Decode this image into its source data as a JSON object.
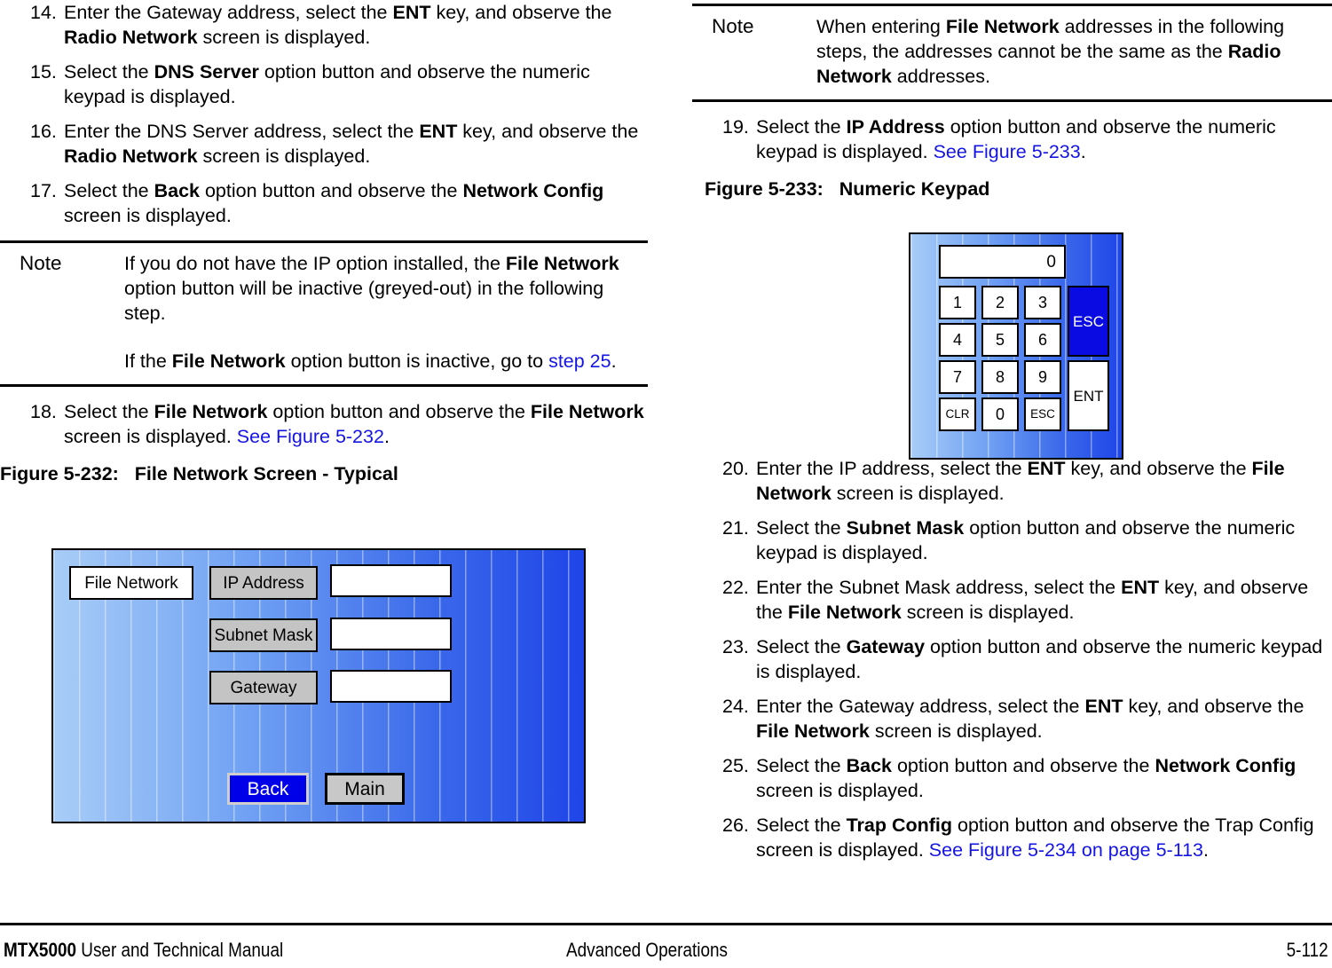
{
  "document": {
    "footer": {
      "manual_bold": "MTX5000",
      "manual_rest": " User and Technical Manual",
      "section": "Advanced Operations",
      "page": "5-112"
    }
  },
  "left_column": {
    "steps_before_note": [
      {
        "number": "14.",
        "segments": [
          {
            "t": "Enter the Gateway address, select the ",
            "s": "plain"
          },
          {
            "t": "ENT",
            "s": "bold"
          },
          {
            "t": " key, and observe the ",
            "s": "plain"
          },
          {
            "t": "Radio Network",
            "s": "bold"
          },
          {
            "t": " screen is displayed.",
            "s": "plain"
          }
        ]
      },
      {
        "number": "15.",
        "segments": [
          {
            "t": "Select the ",
            "s": "plain"
          },
          {
            "t": "DNS Server",
            "s": "bold"
          },
          {
            "t": " option button and observe the numeric keypad is displayed.",
            "s": "plain"
          }
        ]
      },
      {
        "number": "16.",
        "segments": [
          {
            "t": "Enter the DNS Server address, select the ",
            "s": "plain"
          },
          {
            "t": "ENT",
            "s": "bold"
          },
          {
            "t": " key, and observe the ",
            "s": "plain"
          },
          {
            "t": "Radio Network",
            "s": "bold"
          },
          {
            "t": " screen is displayed.",
            "s": "plain"
          }
        ]
      },
      {
        "number": "17.",
        "segments": [
          {
            "t": "Select the ",
            "s": "plain"
          },
          {
            "t": "Back",
            "s": "bold"
          },
          {
            "t": " option button and observe the ",
            "s": "plain"
          },
          {
            "t": "Network Config",
            "s": "bold"
          },
          {
            "t": " screen is displayed.",
            "s": "plain"
          }
        ]
      }
    ],
    "note": {
      "label": "Note",
      "paragraphs": [
        [
          {
            "t": "If you do not have the IP option installed, the ",
            "s": "plain"
          },
          {
            "t": "File Network",
            "s": "bold"
          },
          {
            "t": " option button will be inactive (greyed-out) in the following step.",
            "s": "plain"
          }
        ],
        [
          {
            "t": "If the ",
            "s": "plain"
          },
          {
            "t": "File Network",
            "s": "bold"
          },
          {
            "t": " option button is inactive, go to ",
            "s": "plain"
          },
          {
            "t": "step 25",
            "s": "link"
          },
          {
            "t": ".",
            "s": "plain"
          }
        ]
      ]
    },
    "steps_after_note": [
      {
        "number": "18.",
        "segments": [
          {
            "t": "Select the ",
            "s": "plain"
          },
          {
            "t": "File Network",
            "s": "bold"
          },
          {
            "t": " option button and observe the ",
            "s": "plain"
          },
          {
            "t": "File Network",
            "s": "bold"
          },
          {
            "t": " screen is displayed.  ",
            "s": "plain"
          },
          {
            "t": "See Figure 5-232",
            "s": "link"
          },
          {
            "t": ".",
            "s": "plain"
          }
        ]
      }
    ],
    "figure": {
      "caption": "Figure 5-232:   File Network Screen - Typical",
      "screen": {
        "title_button": "File Network",
        "rows": [
          {
            "option": "IP Address",
            "value": ""
          },
          {
            "option": "Subnet Mask",
            "value": ""
          },
          {
            "option": "Gateway",
            "value": ""
          }
        ],
        "back_button": "Back",
        "main_button": "Main"
      }
    }
  },
  "right_column": {
    "note": {
      "label": "Note",
      "paragraphs": [
        [
          {
            "t": "When entering ",
            "s": "plain"
          },
          {
            "t": "File Network",
            "s": "bold"
          },
          {
            "t": " addresses in the following steps, the addresses cannot be the same as the ",
            "s": "plain"
          },
          {
            "t": "Radio Network",
            "s": "bold"
          },
          {
            "t": " addresses.",
            "s": "plain"
          }
        ]
      ]
    },
    "steps_before_figure": [
      {
        "number": "19.",
        "segments": [
          {
            "t": "Select the ",
            "s": "plain"
          },
          {
            "t": "IP Address",
            "s": "bold"
          },
          {
            "t": " option button and observe the numeric keypad is displayed.  ",
            "s": "plain"
          },
          {
            "t": "See Figure 5-233",
            "s": "link"
          },
          {
            "t": ".",
            "s": "plain"
          }
        ]
      }
    ],
    "figure": {
      "caption": "Figure 5-233:   Numeric Keypad",
      "keypad": {
        "display_value": "0",
        "keys": [
          "1",
          "2",
          "3",
          "4",
          "5",
          "6",
          "7",
          "8",
          "9",
          "CLR",
          "0",
          "ESC"
        ],
        "esc_tall": "ESC",
        "ent_tall": "ENT"
      }
    },
    "steps_after_figure": [
      {
        "number": "20.",
        "segments": [
          {
            "t": "Enter the IP address, select the ",
            "s": "plain"
          },
          {
            "t": "ENT",
            "s": "bold"
          },
          {
            "t": " key, and observe the ",
            "s": "plain"
          },
          {
            "t": "File Network",
            "s": "bold"
          },
          {
            "t": " screen is displayed.",
            "s": "plain"
          }
        ]
      },
      {
        "number": "21.",
        "segments": [
          {
            "t": "Select the ",
            "s": "plain"
          },
          {
            "t": "Subnet Mask",
            "s": "bold"
          },
          {
            "t": " option button and observe the numeric keypad is displayed.",
            "s": "plain"
          }
        ]
      },
      {
        "number": "22.",
        "segments": [
          {
            "t": "Enter the Subnet Mask address, select the ",
            "s": "plain"
          },
          {
            "t": "ENT",
            "s": "bold"
          },
          {
            "t": " key, and observe the ",
            "s": "plain"
          },
          {
            "t": "File Network",
            "s": "bold"
          },
          {
            "t": " screen is displayed.",
            "s": "plain"
          }
        ]
      },
      {
        "number": "23.",
        "segments": [
          {
            "t": "Select the ",
            "s": "plain"
          },
          {
            "t": "Gateway",
            "s": "bold"
          },
          {
            "t": " option button and observe the numeric keypad is displayed.",
            "s": "plain"
          }
        ]
      },
      {
        "number": "24.",
        "segments": [
          {
            "t": "Enter the Gateway address, select the ",
            "s": "plain"
          },
          {
            "t": "ENT",
            "s": "bold"
          },
          {
            "t": " key, and observe the ",
            "s": "plain"
          },
          {
            "t": "File Network",
            "s": "bold"
          },
          {
            "t": " screen is displayed.",
            "s": "plain"
          }
        ]
      },
      {
        "number": "25.",
        "segments": [
          {
            "t": "Select the ",
            "s": "plain"
          },
          {
            "t": "Back",
            "s": "bold"
          },
          {
            "t": " option button and observe the ",
            "s": "plain"
          },
          {
            "t": "Network Config",
            "s": "bold"
          },
          {
            "t": " screen is displayed.",
            "s": "plain"
          }
        ]
      },
      {
        "number": "26.",
        "segments": [
          {
            "t": "Select the ",
            "s": "plain"
          },
          {
            "t": "Trap Config",
            "s": "bold"
          },
          {
            "t": " option button and observe the Trap Config screen is displayed.  ",
            "s": "plain"
          },
          {
            "t": "See Figure 5-234 on page 5-113",
            "s": "link"
          },
          {
            "t": ".",
            "s": "plain"
          }
        ]
      }
    ]
  }
}
